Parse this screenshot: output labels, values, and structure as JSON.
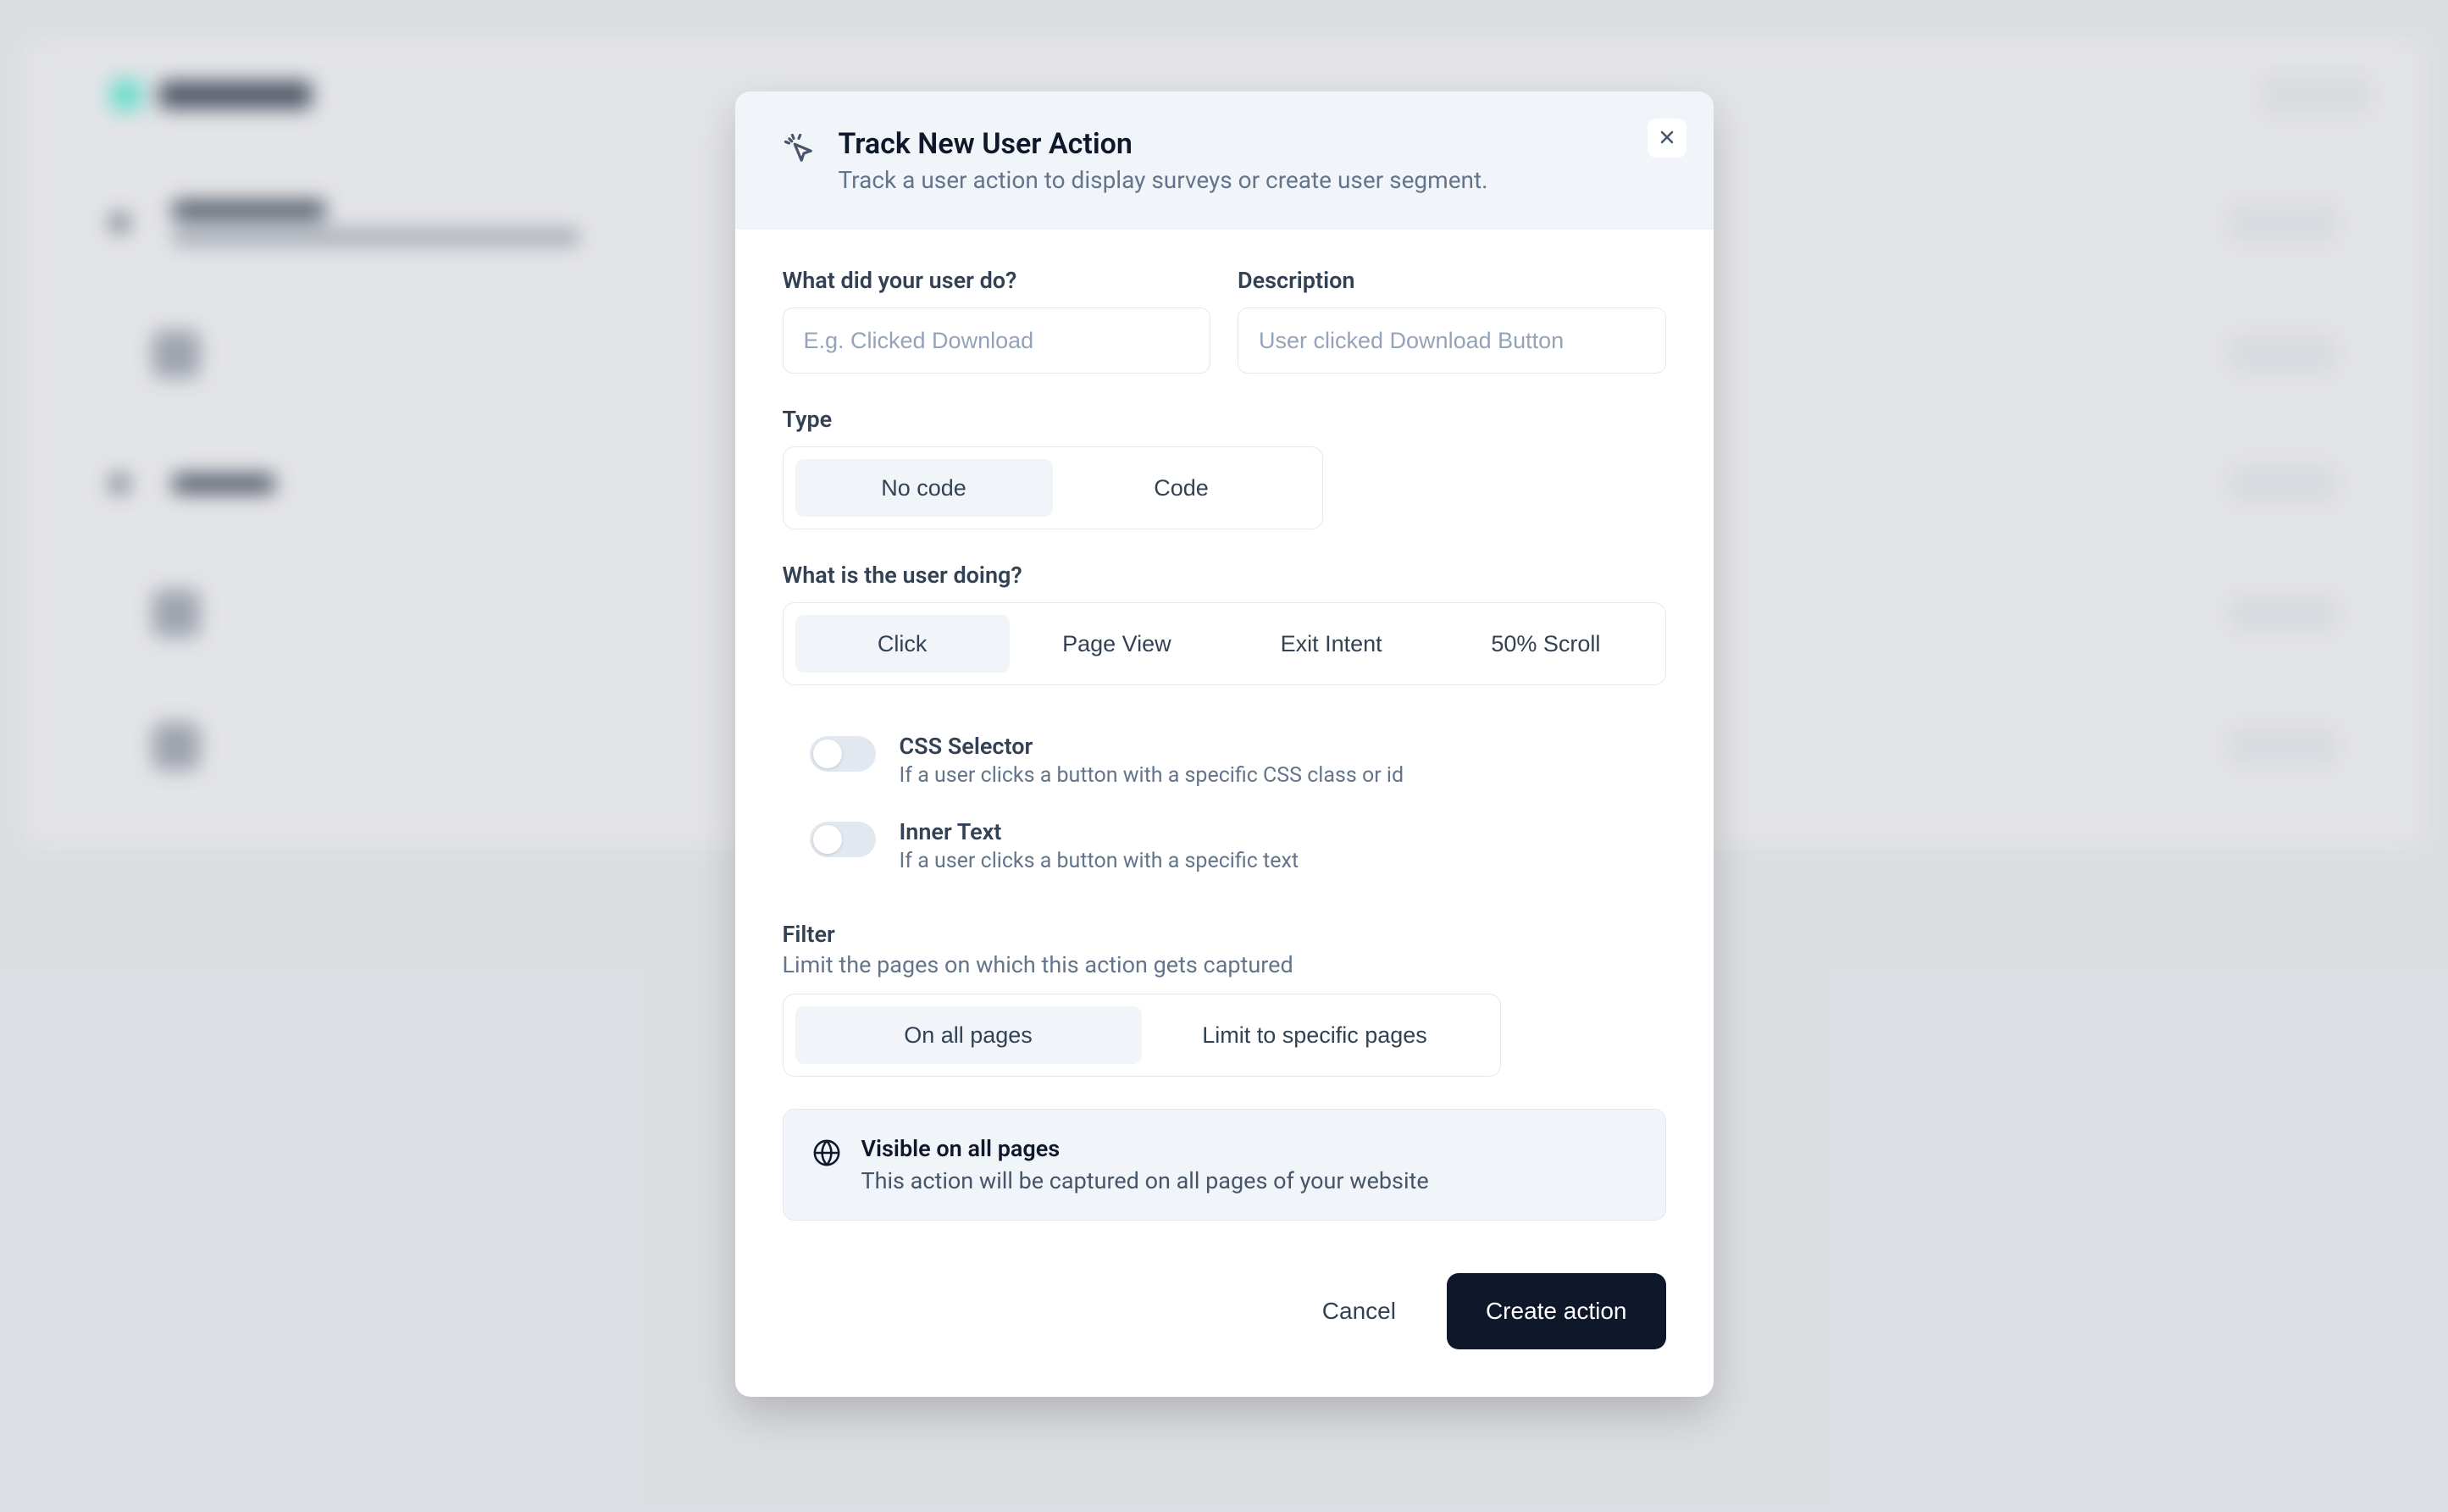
{
  "modal": {
    "title": "Track New User Action",
    "subtitle": "Track a user action to display surveys or create user segment.",
    "fields": {
      "action_name_label": "What did your user do?",
      "action_name_placeholder": "E.g. Clicked Download",
      "description_label": "Description",
      "description_placeholder": "User clicked Download Button"
    },
    "type": {
      "label": "Type",
      "options": {
        "no_code": "No code",
        "code": "Code"
      },
      "selected": "no_code"
    },
    "user_doing": {
      "label": "What is the user doing?",
      "options": {
        "click": "Click",
        "page_view": "Page View",
        "exit_intent": "Exit Intent",
        "scroll_50": "50% Scroll"
      },
      "selected": "click"
    },
    "toggles": {
      "css_selector": {
        "label": "CSS Selector",
        "desc": "If a user clicks a button with a specific CSS class or id",
        "on": false
      },
      "inner_text": {
        "label": "Inner Text",
        "desc": "If a user clicks a button with a specific text",
        "on": false
      }
    },
    "filter": {
      "label": "Filter",
      "sub": "Limit the pages on which this action gets captured",
      "options": {
        "all": "On all pages",
        "specific": "Limit to specific pages"
      },
      "selected": "all"
    },
    "info": {
      "title": "Visible on all pages",
      "desc": "This action will be captured on all pages of your website"
    },
    "buttons": {
      "cancel": "Cancel",
      "create": "Create action"
    }
  }
}
